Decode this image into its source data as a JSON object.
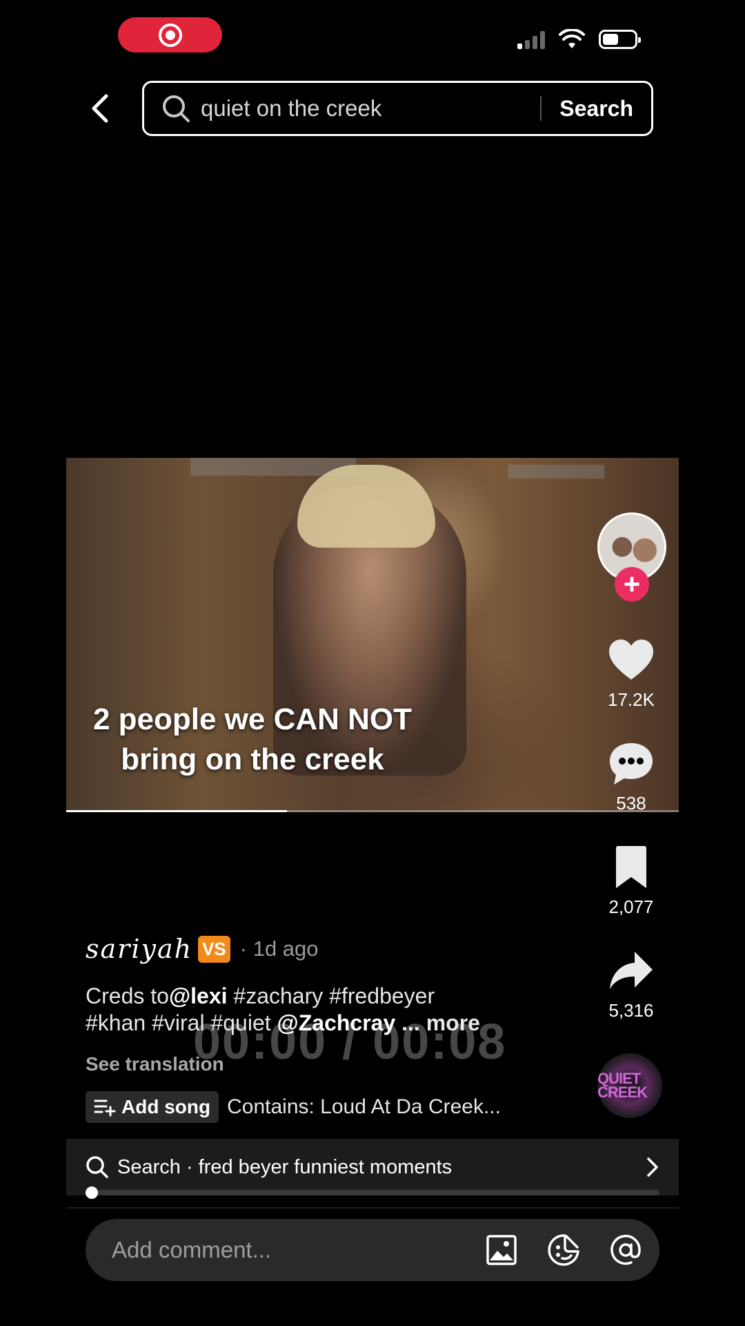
{
  "status_bar": {
    "recording_icon": "screen-record-icon",
    "signal_icon": "cellular-signal-icon",
    "wifi_icon": "wifi-icon",
    "battery_icon": "battery-icon",
    "battery_level": 0.5
  },
  "header": {
    "back_icon": "chevron-left-icon",
    "search_icon": "search-icon",
    "search_value": "quiet on the creek",
    "search_button": "Search"
  },
  "video": {
    "caption_line1": "2 people we CAN NOT",
    "caption_line2": "bring on the creek",
    "progress": 0.36
  },
  "rail": {
    "likes": "17.2K",
    "comments": "538",
    "saves": "2,077",
    "shares": "5,316",
    "follow_symbol": "+",
    "music_disc_label": "QUIET CREEK"
  },
  "post": {
    "author": "sariyah",
    "badge": "VS",
    "time": "· 1d ago",
    "desc_prefix": "Creds to",
    "mention1": "@lexi",
    "tags_line1": " #zachary #fredbeyer",
    "tags_line2": "#khan #viral #quiet ",
    "mention2": "@Zachcray",
    "more": " ... more",
    "timecode": "00:00  /  00:08",
    "see_translation": "See translation",
    "add_song": "Add song",
    "contains": "Contains: Loud At Da Creek..."
  },
  "suggestion": {
    "text": "Search · fred beyer funniest moments",
    "chevron_icon": "chevron-right-icon"
  },
  "comment_bar": {
    "placeholder": "Add comment...",
    "image_icon": "image-icon",
    "emoji_icon": "emoji-icon",
    "mention_icon": "at-mention-icon"
  },
  "colors": {
    "accent_red": "#e0243a",
    "follow_pink": "#ea2d62",
    "badge_orange": "#f28a1a"
  }
}
